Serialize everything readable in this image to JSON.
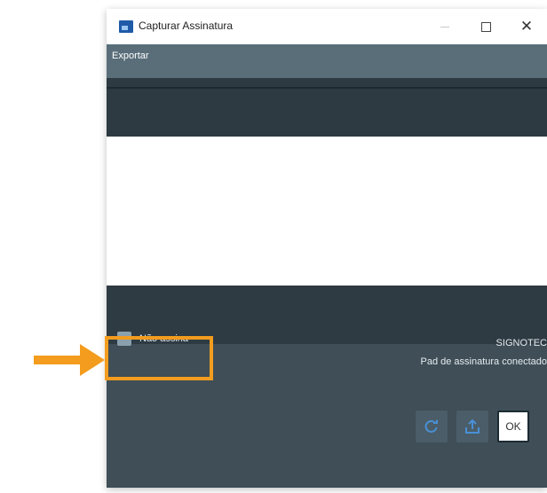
{
  "window": {
    "title": "Capturar Assinatura"
  },
  "menubar": {
    "items": [
      {
        "label": "Exportar"
      }
    ]
  },
  "checkbox": {
    "label": "Não assina",
    "checked": false
  },
  "status": {
    "brand": "SIGNOTEC",
    "message": "Pad de assinatura conectado"
  },
  "buttons": {
    "ok_label": "OK"
  },
  "colors": {
    "titlebar_bg": "#ffffff",
    "menubar_bg": "#5a6e7a",
    "dark_panel_bg": "#2d3a42",
    "bottom_panel_bg": "#3f4e57",
    "accent_blue": "#4a90d6",
    "highlight_orange": "#f39c1e"
  },
  "icons": {
    "app": "app-window-icon",
    "refresh": "refresh-icon",
    "upload": "upload-icon",
    "arrow": "arrow-right-icon"
  }
}
